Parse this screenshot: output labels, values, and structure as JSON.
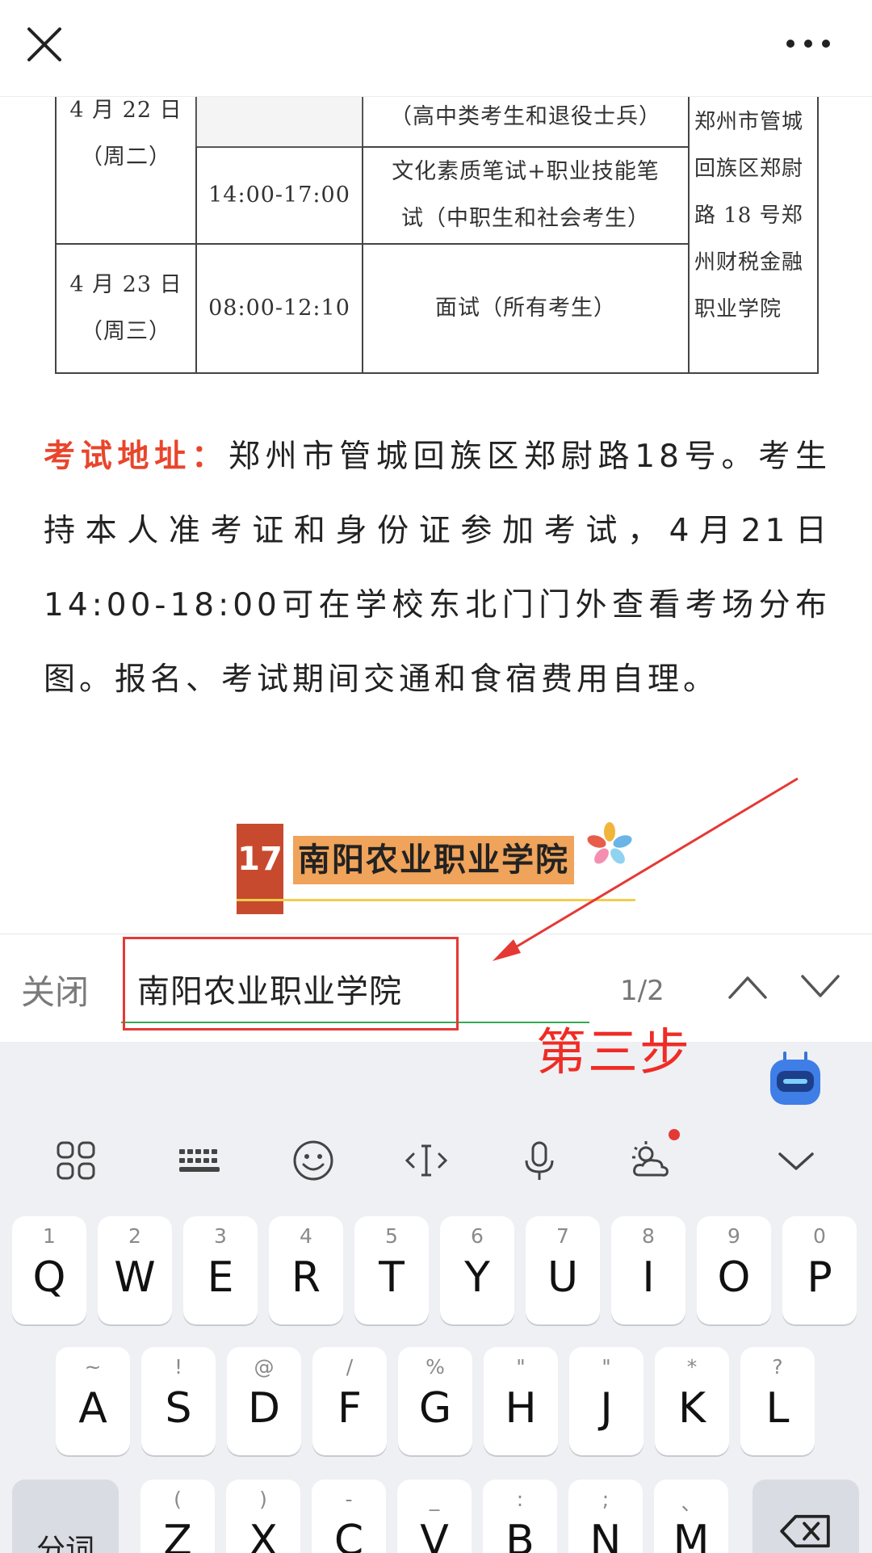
{
  "topbar": {
    "close_icon": "close-icon",
    "more_icon": "more-dots-icon"
  },
  "table": {
    "rows": [
      {
        "date": "4 月 22 日\n（周二）",
        "time": "",
        "subject": "（高中类考生和退役士兵）"
      },
      {
        "date": "",
        "time": "14:00-17:00",
        "subject": "文化素质笔试+职业技能笔\n试（中职生和社会考生）"
      },
      {
        "date": "4 月 23 日\n（周三）",
        "time": "08:00-12:10",
        "subject": "面试（所有考生）"
      }
    ],
    "location": "郑州市管城\n回族区郑尉\n路 18 号郑\n州财税金融\n职业学院"
  },
  "address": {
    "label": "考试地址：",
    "text": "郑州市管城回族区郑尉路18号。考生持本人准考证和身份证参加考试，4月21日14:00-18:00可在学校东北门门外查看考场分布图。报名、考试期间交通和食宿费用自理。"
  },
  "section": {
    "number": "17",
    "title": "南阳农业职业学院"
  },
  "findbar": {
    "close_label": "关闭",
    "query": "南阳农业职业学院",
    "count": "1/2"
  },
  "annotation": {
    "step_label": "第三步",
    "color": "#e53935"
  },
  "keyboard": {
    "row1": [
      {
        "hint": "1",
        "key": "Q"
      },
      {
        "hint": "2",
        "key": "W"
      },
      {
        "hint": "3",
        "key": "E"
      },
      {
        "hint": "4",
        "key": "R"
      },
      {
        "hint": "5",
        "key": "T"
      },
      {
        "hint": "6",
        "key": "Y"
      },
      {
        "hint": "7",
        "key": "U"
      },
      {
        "hint": "8",
        "key": "I"
      },
      {
        "hint": "9",
        "key": "O"
      },
      {
        "hint": "0",
        "key": "P"
      }
    ],
    "row2": [
      {
        "hint": "~",
        "key": "A"
      },
      {
        "hint": "!",
        "key": "S"
      },
      {
        "hint": "@",
        "key": "D"
      },
      {
        "hint": "/",
        "key": "F"
      },
      {
        "hint": "%",
        "key": "G"
      },
      {
        "hint": "\"",
        "key": "H"
      },
      {
        "hint": "\"",
        "key": "J"
      },
      {
        "hint": "*",
        "key": "K"
      },
      {
        "hint": "?",
        "key": "L"
      }
    ],
    "row3": [
      {
        "hint": "(",
        "key": "Z"
      },
      {
        "hint": ")",
        "key": "X"
      },
      {
        "hint": "-",
        "key": "C"
      },
      {
        "hint": "_",
        "key": "V"
      },
      {
        "hint": ":",
        "key": "B"
      },
      {
        "hint": ";",
        "key": "N"
      },
      {
        "hint": "、",
        "key": "M"
      }
    ],
    "split_label": "分词",
    "toolbar_icons": [
      "grid-icon",
      "keyboard-icon",
      "emoji-icon",
      "cursor-icon",
      "mic-icon",
      "weather-icon",
      "collapse-icon"
    ]
  }
}
